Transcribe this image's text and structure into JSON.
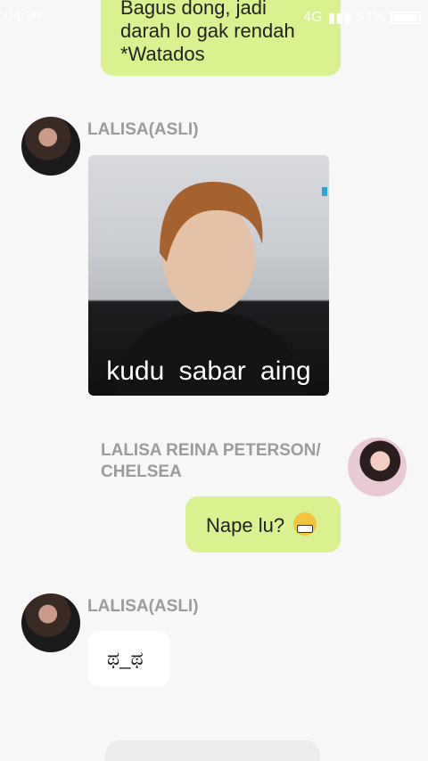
{
  "status_bar": {
    "time": "04:56",
    "network": "4G",
    "battery": "91%"
  },
  "messages": [
    {
      "side": "right",
      "lines": [
        "Bagus dong, jadi",
        "darah lo gak rendah",
        "*Watados"
      ]
    },
    {
      "side": "left",
      "sender": "LALISA(ASLI)",
      "type": "image",
      "caption": "kudu sabar aing"
    },
    {
      "side": "right",
      "sender": "LALISA REINA PETERSON/ CHELSEA",
      "text": "Nape lu?",
      "emoji": "grimacing-face"
    },
    {
      "side": "left",
      "sender": "LALISA(ASLI)",
      "text": "ಥ_ಥ"
    }
  ],
  "colors": {
    "background": "#f7f7f7",
    "outgoing_bubble": "#d9f18f",
    "incoming_bubble": "#ffffff",
    "sender_name": "#9b9b9b"
  }
}
